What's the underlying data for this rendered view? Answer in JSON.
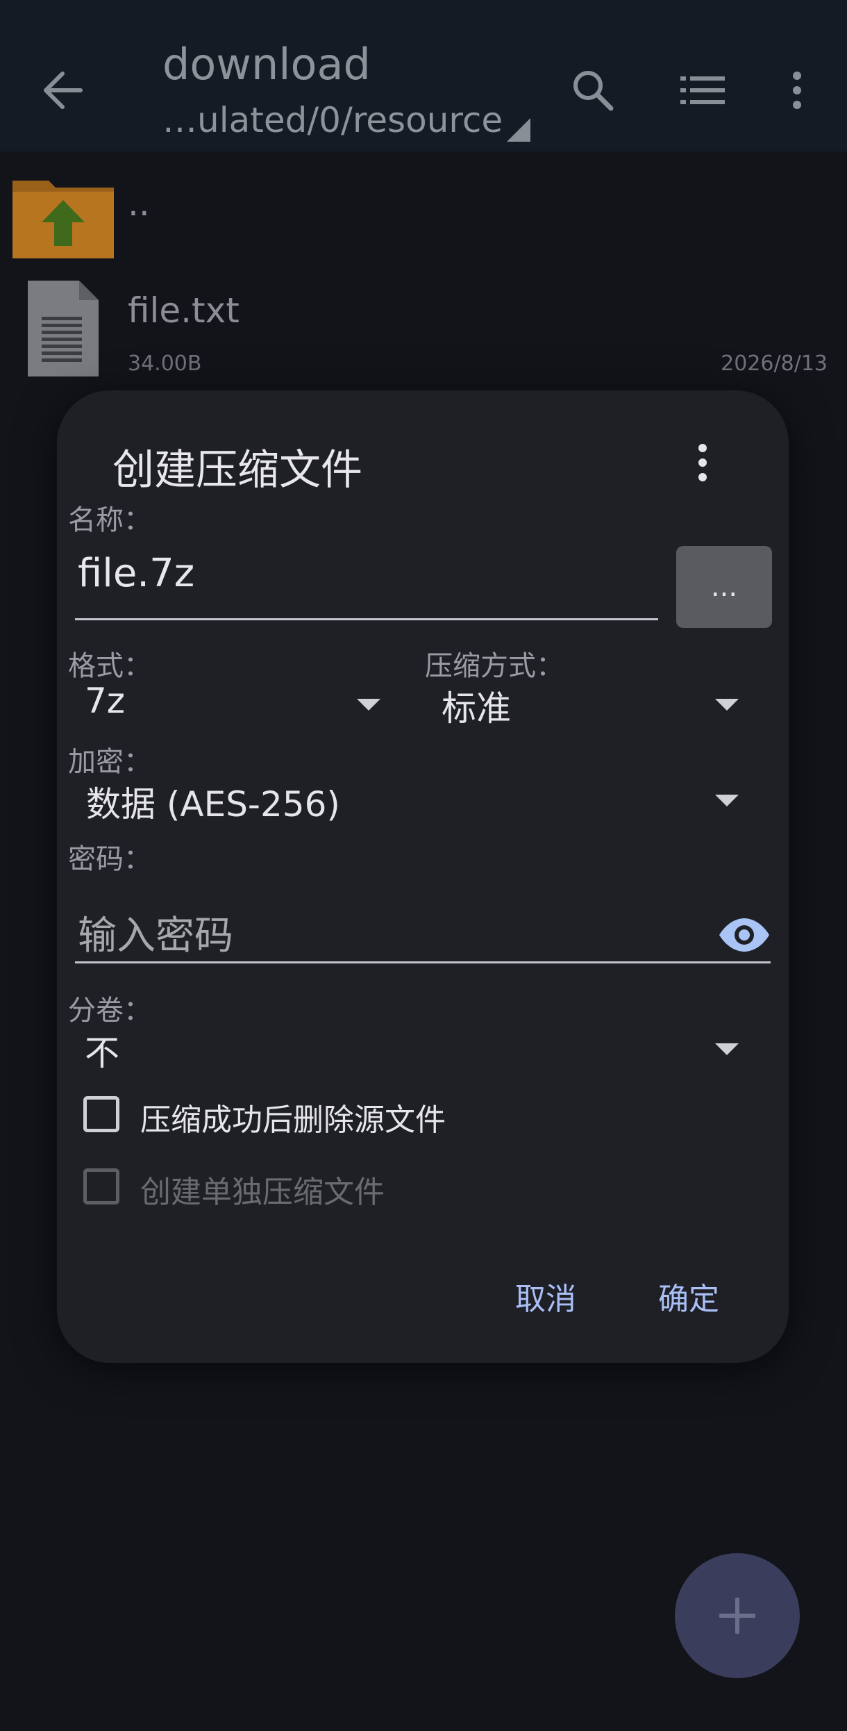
{
  "appbar": {
    "title": "download",
    "subtitle": "…ulated/0/resource",
    "icons": [
      "arrow-back-icon",
      "search-icon",
      "list-view-icon",
      "more-vert-icon"
    ]
  },
  "files": {
    "parent_label": "..",
    "items": [
      {
        "name": "file.txt",
        "size": "34.00B",
        "date": "2026/8/13"
      }
    ]
  },
  "dialog": {
    "title": "创建压缩文件",
    "name_label": "名称：",
    "name_value": "file.7z",
    "browse_label": "...",
    "format_label": "格式：",
    "format_value": "7z",
    "method_label": "压缩方式：",
    "method_value": "标准",
    "encrypt_label": "加密：",
    "encrypt_value": "数据 (AES-256)",
    "password_label": "密码：",
    "password_placeholder": "输入密码",
    "split_label": "分卷：",
    "split_value": "不",
    "delete_source_label": "压缩成功后删除源文件",
    "delete_source_checked": false,
    "separate_archives_label": "创建单独压缩文件",
    "separate_archives_enabled": false,
    "cancel_label": "取消",
    "ok_label": "确定"
  },
  "colors": {
    "background": "#131419",
    "appbar": "#151b25",
    "dialog": "#1f2026",
    "accent": "#a9bff6",
    "eye_icon": "#a9c4f5",
    "fab": "#3a3d5c",
    "folder": "#c07a1e",
    "folder_arrow": "#4b7a1f"
  }
}
